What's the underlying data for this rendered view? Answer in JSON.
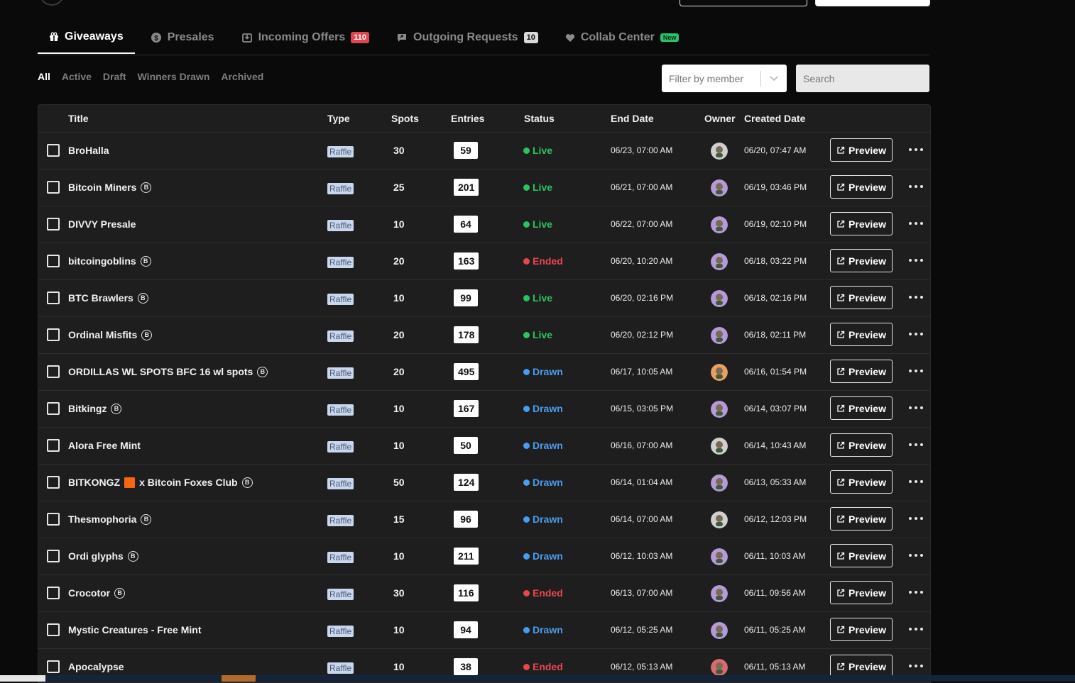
{
  "tabs": [
    {
      "label": "Giveaways",
      "icon": "gift-icon",
      "active": true
    },
    {
      "label": "Presales",
      "icon": "dollar-circle-icon"
    },
    {
      "label": "Incoming Offers",
      "icon": "inbox-download-icon",
      "badge": "110"
    },
    {
      "label": "Outgoing Requests",
      "icon": "send-message-icon",
      "badge": "10"
    },
    {
      "label": "Collab Center",
      "icon": "heart-icon",
      "badge": "New"
    }
  ],
  "filters": [
    "All",
    "Active",
    "Draft",
    "Winners Drawn",
    "Archived"
  ],
  "member_filter": {
    "placeholder": "Filter by member"
  },
  "search": {
    "placeholder": "Search"
  },
  "columns": {
    "title": "Title",
    "type": "Type",
    "spots": "Spots",
    "entries": "Entries",
    "status": "Status",
    "end_date": "End Date",
    "owner": "Owner",
    "created_date": "Created Date"
  },
  "preview_label": "Preview",
  "rows": [
    {
      "title": "BroHalla",
      "chain": "sol",
      "type": "Raffle",
      "spots": "30",
      "entries": "59",
      "status": "Live",
      "end": "06/23, 07:00 AM",
      "created": "06/20, 07:47 AM",
      "avatar": "avatar-grey"
    },
    {
      "title": "Bitcoin Miners",
      "chain": "btc",
      "type": "Raffle",
      "spots": "25",
      "entries": "201",
      "status": "Live",
      "end": "06/21, 07:00 AM",
      "created": "06/19, 03:46 PM",
      "avatar": "avatar-purple"
    },
    {
      "title": "DIVVY Presale",
      "chain": "sol",
      "type": "Raffle",
      "spots": "10",
      "entries": "64",
      "status": "Live",
      "end": "06/22, 07:00 AM",
      "created": "06/19, 02:10 PM",
      "avatar": "avatar-purple"
    },
    {
      "title": "bitcoingoblins",
      "chain": "btc",
      "type": "Raffle",
      "spots": "20",
      "entries": "163",
      "status": "Ended",
      "end": "06/20, 10:20 AM",
      "created": "06/18, 03:22 PM",
      "avatar": "avatar-purple"
    },
    {
      "title": "BTC Brawlers",
      "chain": "btc",
      "type": "Raffle",
      "spots": "10",
      "entries": "99",
      "status": "Live",
      "end": "06/20, 02:16 PM",
      "created": "06/18, 02:16 PM",
      "avatar": "avatar-purple"
    },
    {
      "title": "Ordinal Misfits",
      "chain": "btc",
      "type": "Raffle",
      "spots": "20",
      "entries": "178",
      "status": "Live",
      "end": "06/20, 02:12 PM",
      "created": "06/18, 02:11 PM",
      "avatar": "avatar-purple"
    },
    {
      "title": "ORDILLAS WL SPOTS BFC 16 wl spots",
      "chain": "btc",
      "type": "Raffle",
      "spots": "20",
      "entries": "495",
      "status": "Drawn",
      "end": "06/17, 10:05 AM",
      "created": "06/16, 01:54 PM",
      "avatar": "avatar-orange"
    },
    {
      "title": "Bitkingz",
      "chain": "btc",
      "type": "Raffle",
      "spots": "10",
      "entries": "167",
      "status": "Drawn",
      "end": "06/15, 03:05 PM",
      "created": "06/14, 03:07 PM",
      "avatar": "avatar-purple"
    },
    {
      "title": "Alora Free Mint",
      "chain": "sol",
      "type": "Raffle",
      "spots": "10",
      "entries": "50",
      "status": "Drawn",
      "end": "06/16, 07:00 AM",
      "created": "06/14, 10:43 AM",
      "avatar": "avatar-grey"
    },
    {
      "title": "BITKONGZ",
      "title_suffix": "x Bitcoin Foxes Club",
      "emoji": true,
      "chain": "btc",
      "type": "Raffle",
      "spots": "50",
      "entries": "124",
      "status": "Drawn",
      "end": "06/14, 01:04 AM",
      "created": "06/13, 05:33 AM",
      "avatar": "avatar-purple"
    },
    {
      "title": "Thesmophoria",
      "chain": "btc",
      "type": "Raffle",
      "spots": "15",
      "entries": "96",
      "status": "Drawn",
      "end": "06/14, 07:00 AM",
      "created": "06/12, 12:03 PM",
      "avatar": "avatar-grey"
    },
    {
      "title": "Ordi glyphs",
      "chain": "btc",
      "type": "Raffle",
      "spots": "10",
      "entries": "211",
      "status": "Drawn",
      "end": "06/12, 10:03 AM",
      "created": "06/11, 10:03 AM",
      "avatar": "avatar-purple"
    },
    {
      "title": "Crocotor",
      "chain": "btc",
      "type": "Raffle",
      "spots": "30",
      "entries": "116",
      "status": "Ended",
      "end": "06/13, 07:00 AM",
      "created": "06/11, 09:56 AM",
      "avatar": "avatar-purple"
    },
    {
      "title": "Mystic Creatures - Free Mint",
      "chain": "sol",
      "type": "Raffle",
      "spots": "10",
      "entries": "94",
      "status": "Drawn",
      "end": "06/12, 05:25 AM",
      "created": "06/11, 05:25 AM",
      "avatar": "avatar-purple"
    },
    {
      "title": "Apocalypse",
      "chain": "sol",
      "type": "Raffle",
      "spots": "10",
      "entries": "38",
      "status": "Ended",
      "end": "06/12, 05:13 AM",
      "created": "06/11, 05:13 AM",
      "avatar": "avatar-red"
    }
  ]
}
